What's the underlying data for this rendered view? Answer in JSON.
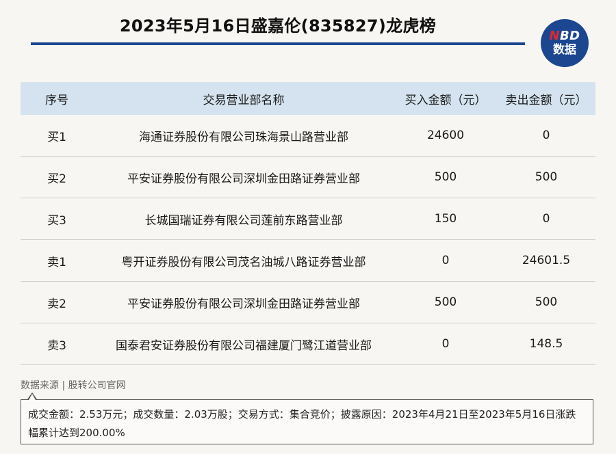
{
  "title": "2023年5月16日盛嘉伦(835827)龙虎榜",
  "logo": {
    "line1_n": "N",
    "line1_rest": "BD",
    "line2": "数据"
  },
  "table": {
    "headers": [
      "序号",
      "交易营业部名称",
      "买入金额（元）",
      "卖出金额（元）"
    ],
    "rows": [
      [
        "买1",
        "海通证券股份有限公司珠海景山路营业部",
        "24600",
        "0"
      ],
      [
        "买2",
        "平安证券股份有限公司深圳金田路证券营业部",
        "500",
        "500"
      ],
      [
        "买3",
        "长城国瑞证券有限公司莲前东路营业部",
        "150",
        "0"
      ],
      [
        "卖1",
        "粤开证券股份有限公司茂名油城八路证券营业部",
        "0",
        "24601.5"
      ],
      [
        "卖2",
        "平安证券股份有限公司深圳金田路证券营业部",
        "500",
        "500"
      ],
      [
        "卖3",
        "国泰君安证券股份有限公司福建厦门鹭江道营业部",
        "0",
        "148.5"
      ]
    ]
  },
  "source": "数据来源 | 股转公司官网",
  "note": "成交金额：2.53万元；成交数量：2.03万股；交易方式：集合竞价；披露原因：2023年4月21日至2023年5月16日涨跌幅累计达到200.00%",
  "colors": {
    "accent": "#1c4690",
    "header_bg": "#d4e3ef",
    "logo_red": "#e4262a"
  }
}
